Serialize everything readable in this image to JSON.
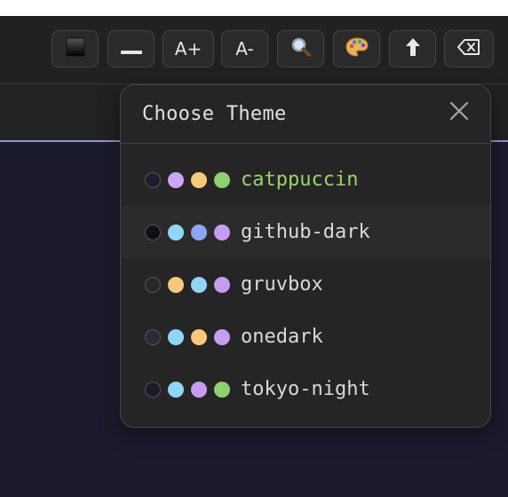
{
  "toolbar": {
    "buttons": [
      {
        "name": "theme-preview-button",
        "label": "",
        "icon": "black-square-icon"
      },
      {
        "name": "minimize-button",
        "label": "",
        "icon": "minus-icon"
      },
      {
        "name": "font-increase-button",
        "label": "A+",
        "icon": ""
      },
      {
        "name": "font-decrease-button",
        "label": "A-",
        "icon": ""
      },
      {
        "name": "search-button",
        "label": "",
        "icon": "magnifier-icon"
      },
      {
        "name": "theme-palette-button",
        "label": "",
        "icon": "palette-icon"
      },
      {
        "name": "upload-button",
        "label": "",
        "icon": "up-arrow-icon"
      },
      {
        "name": "clear-button",
        "label": "",
        "icon": "backspace-icon"
      }
    ]
  },
  "modal": {
    "title": "Choose Theme",
    "close_label": "✕",
    "themes": [
      {
        "name": "catppuccin",
        "current": true,
        "selected": false,
        "swatches": [
          "#1e1e2e",
          "#cba6f7",
          "#f9c97a",
          "#8fd16f"
        ]
      },
      {
        "name": "github-dark",
        "current": false,
        "selected": true,
        "swatches": [
          "#0d1117",
          "#8fd6f7",
          "#8ca6f5",
          "#c69cf0"
        ]
      },
      {
        "name": "gruvbox",
        "current": false,
        "selected": false,
        "swatches": [
          "#282828",
          "#f9c97a",
          "#8fd6f7",
          "#c69cf0"
        ]
      },
      {
        "name": "onedark",
        "current": false,
        "selected": false,
        "swatches": [
          "#282c34",
          "#8fd6f7",
          "#f9c97a",
          "#c69cf0"
        ]
      },
      {
        "name": "tokyo-night",
        "current": false,
        "selected": false,
        "swatches": [
          "#1a1b26",
          "#8fd6f7",
          "#c69cf0",
          "#8fd16f"
        ]
      }
    ]
  },
  "colors": {
    "current_theme_text": "#9cd36a",
    "editor_background": "#1c1b2d",
    "accent_line": "#8f98c8"
  }
}
